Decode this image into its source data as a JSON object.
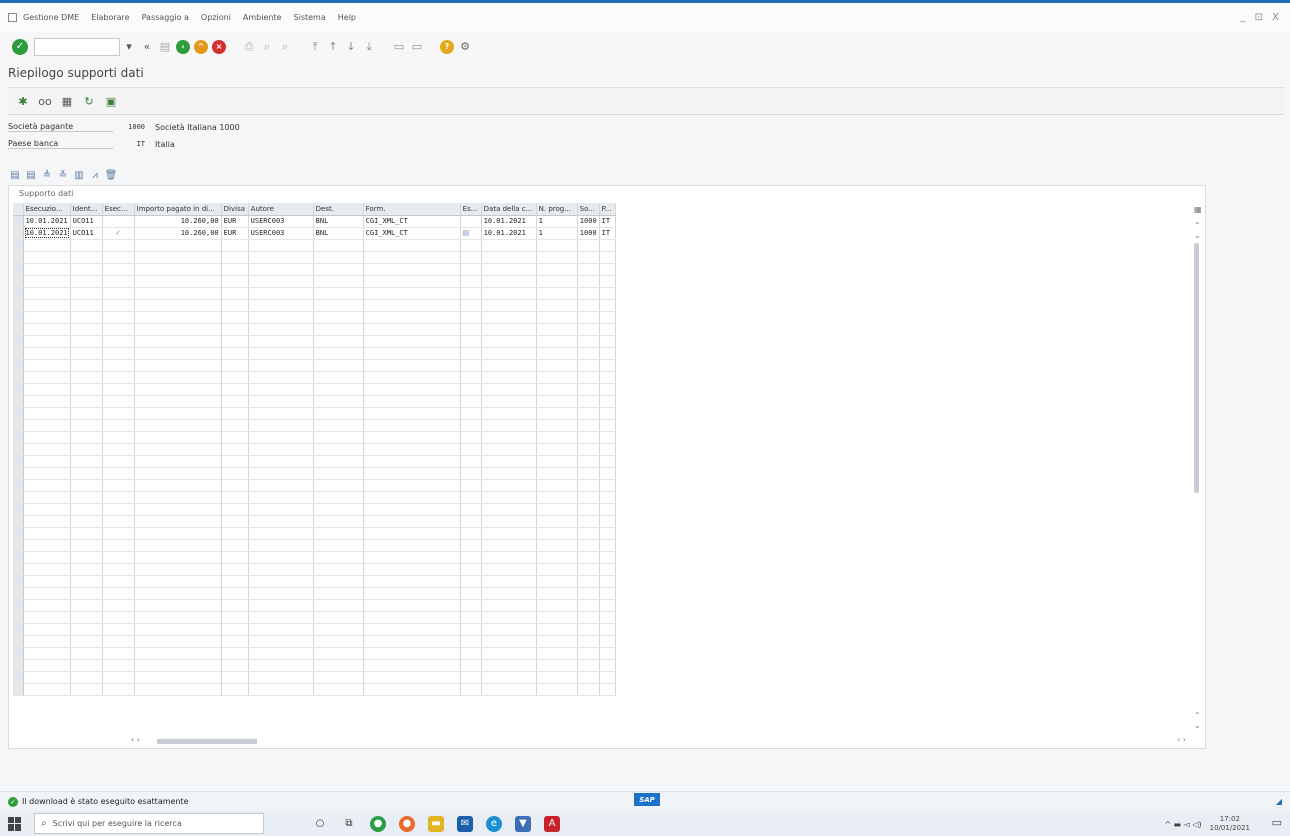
{
  "menu": {
    "items": [
      "Gestione DME",
      "Elaborare",
      "Passaggio a",
      "Opzioni",
      "Ambiente",
      "Sistema",
      "Help"
    ],
    "window_controls": "_ ⊡ X"
  },
  "toolbar": {
    "command_field_value": ""
  },
  "page_title": "Riepilogo supporti dati",
  "header_fields": {
    "company": {
      "label": "Società pagante",
      "value": "1000",
      "desc": "Società Italiana 1000"
    },
    "bank_country": {
      "label": "Paese banca",
      "value": "IT",
      "desc": "Italia"
    }
  },
  "grid": {
    "caption": "Supporto dati",
    "columns": [
      "Esecuzio...",
      "Ident...",
      "Esec...",
      "Importo pagato in di...",
      "Divisa",
      "Autore",
      "Dest.",
      "Form.",
      "Es...",
      "Data della c...",
      "N. prog...",
      "So...",
      "P..."
    ],
    "rows": [
      {
        "exec_date": "10.01.2021",
        "ident": "UCO11",
        "esec": "",
        "amount": "10.260,00",
        "currency": "EUR",
        "author": "USERC003",
        "dest": "BNL",
        "format": "CGI_XML_CT",
        "es": "",
        "creation_date": "10.01.2021",
        "prog": "1",
        "so": "1000",
        "p": "IT"
      },
      {
        "exec_date": "10.01.2021",
        "ident": "UCO11",
        "esec": "✓",
        "amount": "10.260,00",
        "currency": "EUR",
        "author": "USERC003",
        "dest": "BNL",
        "format": "CGI_XML_CT",
        "es": "▤",
        "creation_date": "10.01.2021",
        "prog": "1",
        "so": "1000",
        "p": "IT"
      }
    ],
    "empty_rows": 38
  },
  "status": {
    "message": "Il download è stato eseguito esattamente",
    "sap_logo": "SAP"
  },
  "taskbar": {
    "search_placeholder": "Scrivi qui per eseguire la ricerca",
    "time": "17:02",
    "date": "10/01/2021"
  }
}
